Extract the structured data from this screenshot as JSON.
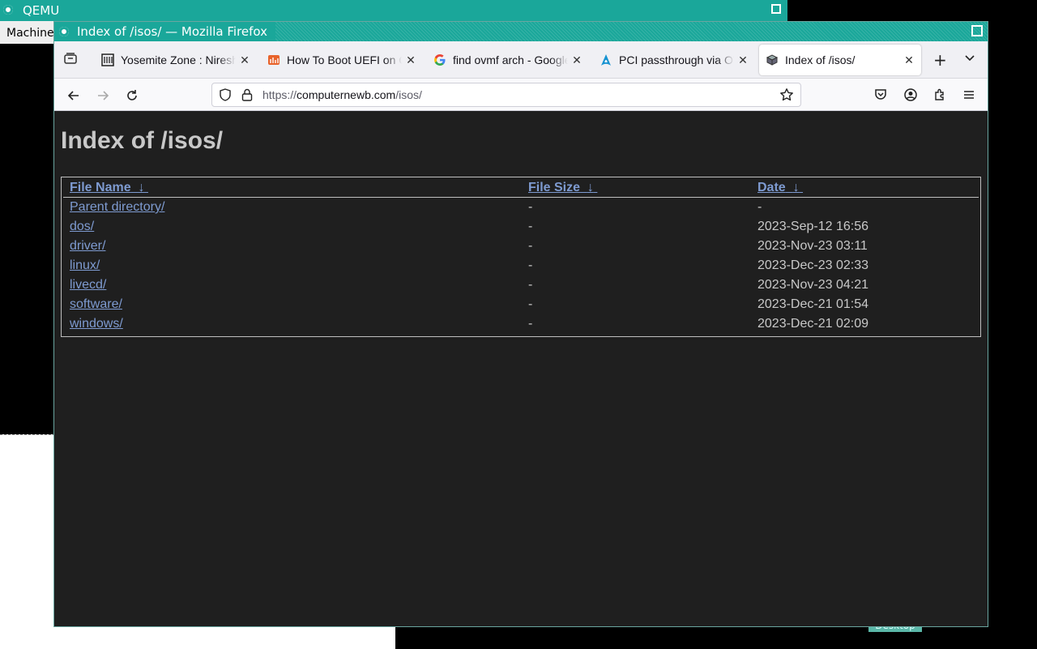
{
  "qemu": {
    "title": "QEMU",
    "menu_label": "Machine",
    "desktop_label": "Desktop"
  },
  "window": {
    "title": "Index of /isos/ — Mozilla Firefox"
  },
  "tabs": [
    {
      "title": "Yosemite Zone : Niresh",
      "icon": "yosemite-favicon"
    },
    {
      "title": "How To Boot UEFI on QEMU",
      "icon": "blog-favicon"
    },
    {
      "title": "find ovmf arch - Google Search",
      "icon": "google-favicon"
    },
    {
      "title": "PCI passthrough via OVMF",
      "icon": "arch-favicon"
    },
    {
      "title": "Index of /isos/",
      "icon": "server-favicon",
      "active": true
    }
  ],
  "urlbar": {
    "scheme": "https://",
    "host": "computernewb.com",
    "path": "/isos/"
  },
  "page": {
    "title": "Index of /isos/",
    "headers": {
      "name": "File Name",
      "size": "File Size",
      "date": "Date",
      "sort_arrow": "↓"
    },
    "rows": [
      {
        "name": "Parent directory/",
        "size": "-",
        "date": "-"
      },
      {
        "name": "dos/",
        "size": "-",
        "date": "2023-Sep-12 16:56"
      },
      {
        "name": "driver/",
        "size": "-",
        "date": "2023-Nov-23 03:11"
      },
      {
        "name": "linux/",
        "size": "-",
        "date": "2023-Dec-23 02:33"
      },
      {
        "name": "livecd/",
        "size": "-",
        "date": "2023-Nov-23 04:21"
      },
      {
        "name": "software/",
        "size": "-",
        "date": "2023-Dec-21 01:54"
      },
      {
        "name": "windows/",
        "size": "-",
        "date": "2023-Dec-21 02:09"
      }
    ]
  },
  "colors": {
    "wm_accent": "#1aa79a",
    "page_bg": "#1f1f1f",
    "link": "#7e9bd1"
  }
}
